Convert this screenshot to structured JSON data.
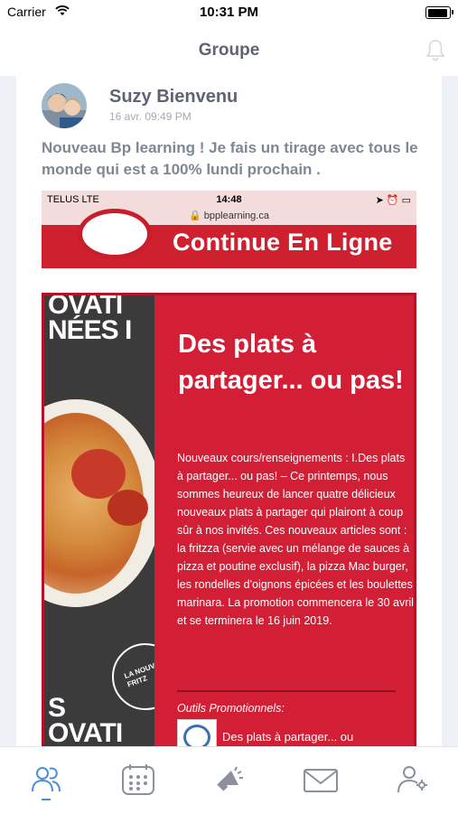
{
  "status_bar": {
    "carrier": "Carrier",
    "time": "10:31 PM"
  },
  "nav": {
    "title": "Groupe",
    "bell_icon": "bell-icon"
  },
  "post": {
    "author": "Suzy Bienvenu",
    "date": "16 avr. 09:49 PM",
    "text": "Nouveau Bp learning ! Je fais un tirage avec tous le monde qui est a 100% lundi prochain .",
    "attachment_1": {
      "status_carrier": "TELUS  LTE",
      "status_time": "14:48",
      "url": "bpplearning.ca",
      "banner": "Continue En Ligne"
    },
    "attachment_2": {
      "left_text_top_1": "OVATI",
      "left_text_top_2": "NÉES I",
      "left_text_bottom_1": "S",
      "left_text_bottom_2": "OVATI",
      "stamp": "LA NOUVELLE FRITZ",
      "title": "Des plats à partager... ou pas!",
      "body": "Nouveaux cours/renseignements : I.Des plats à partager... ou pas! – Ce printemps, nous sommes heureux de lancer quatre délicieux nouveaux plats à partager qui plairont à coup sûr à nos invités. Ces nouveaux articles sont : la fritzza (servie avec un mélange de sauces à pizza et poutine exclusif), la pizza Mac burger, les rondelles d'oignons épicées et les boulettes marinara. La promotion commencera le 30 avril et se terminera le 16 juin 2019.",
      "outils": "Outils Promotionnels:",
      "outils_item": "Des plats à partager... ou"
    }
  },
  "tabs": [
    {
      "icon": "group-icon",
      "active": true
    },
    {
      "icon": "calendar-icon",
      "active": false
    },
    {
      "icon": "megaphone-icon",
      "active": false
    },
    {
      "icon": "mail-icon",
      "active": false
    },
    {
      "icon": "user-settings-icon",
      "active": false
    }
  ],
  "colors": {
    "accent": "#4a8fd6",
    "promo_red": "#d21f35",
    "text_gray": "#5d6474"
  }
}
